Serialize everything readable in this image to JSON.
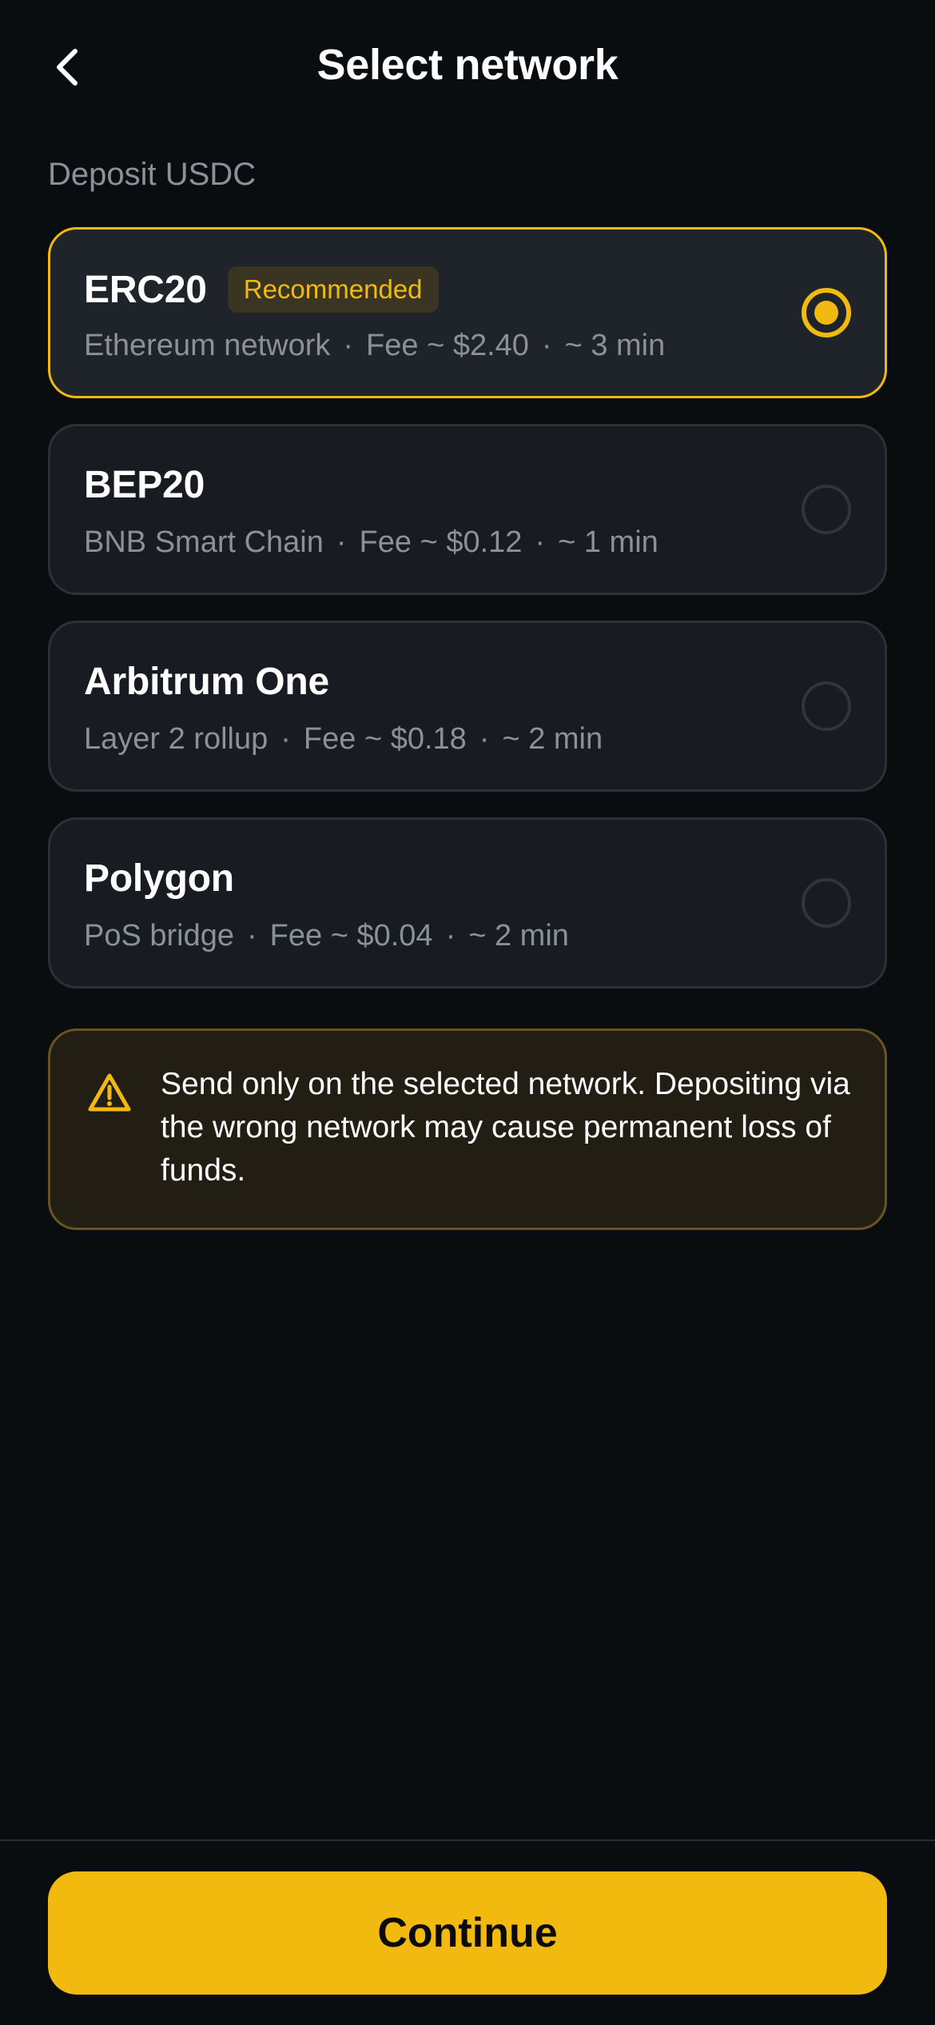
{
  "header": {
    "title": "Select network",
    "back_icon": "chevron-left-icon"
  },
  "section_label": "Deposit USDC",
  "networks": [
    {
      "name": "ERC20",
      "badge": "Recommended",
      "chain": "Ethereum network",
      "fee": "Fee ~ $2.40",
      "time": "~ 3 min",
      "selected": true
    },
    {
      "name": "BEP20",
      "chain": "BNB Smart Chain",
      "fee": "Fee ~ $0.12",
      "time": "~ 1 min",
      "selected": false
    },
    {
      "name": "Arbitrum One",
      "chain": "Layer 2 rollup",
      "fee": "Fee ~ $0.18",
      "time": "~ 2 min",
      "selected": false
    },
    {
      "name": "Polygon",
      "chain": "PoS bridge",
      "fee": "Fee ~ $0.04",
      "time": "~ 2 min",
      "selected": false
    }
  ],
  "separator": "·",
  "warning": {
    "icon": "warning-triangle-icon",
    "text": "Send only on the selected network. Depositing via the wrong network may cause permanent loss of funds."
  },
  "footer": {
    "continue_label": "Continue"
  },
  "colors": {
    "accent": "#f2b90f",
    "background": "#0a0d10",
    "card": "#181b21",
    "muted_text": "#8b919a",
    "warning_bg": "#231e14"
  }
}
